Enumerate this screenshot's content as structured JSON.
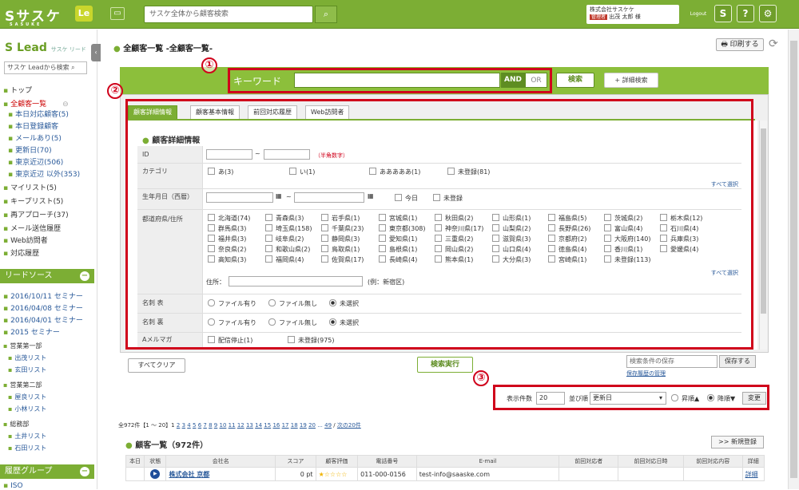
{
  "topbar": {
    "logo": "Sサスケ",
    "logo_sub": "SASUKE",
    "app_badge": "Le",
    "global_search_placeholder": "サスケ全体から顧客検索",
    "company": "株式会社サスケケ",
    "user_role": "管理者",
    "user_name": "出茂 太郎 様",
    "logout": "Logout"
  },
  "sidebar": {
    "logo": "Lead",
    "logo_sub": "サスケ リード",
    "search_placeholder": "サスケ Leadから検索",
    "items": [
      {
        "label": "トップ",
        "type": "top"
      },
      {
        "label": "全顧客一覧",
        "type": "red"
      },
      {
        "label": "本日対応顧客(5)",
        "type": "sub"
      },
      {
        "label": "本日登録顧客",
        "type": "sub"
      },
      {
        "label": "メールあり(5)",
        "type": "sub"
      },
      {
        "label": "更新日(70)",
        "type": "sub"
      },
      {
        "label": "東京近辺(506)",
        "type": "sub"
      },
      {
        "label": "東京近辺 以外(353)",
        "type": "sub"
      },
      {
        "label": "マイリスト(5)",
        "type": "top"
      },
      {
        "label": "キープリスト(5)",
        "type": "top"
      },
      {
        "label": "再アプローチ(37)",
        "type": "top"
      },
      {
        "label": "メール送信履歴",
        "type": "top"
      },
      {
        "label": "Web訪問者",
        "type": "top"
      },
      {
        "label": "対応履歴",
        "type": "top"
      }
    ],
    "lead_source_head": "リードソース",
    "lead_items": [
      "2016/10/11 セミナー",
      "2016/04/08 セミナー",
      "2016/04/01 セミナー",
      "2015 セミナー"
    ],
    "groups": [
      {
        "label": "営業第一部",
        "subs": [
          "出茂リスト",
          "玄田リスト"
        ]
      },
      {
        "label": "営業第二部",
        "subs": [
          "屋良リスト",
          "小林リスト"
        ]
      },
      {
        "label": "総務部",
        "subs": [
          "土井リスト",
          "石田リスト"
        ]
      }
    ],
    "history_head": "履歴グループ",
    "history_item": "ISO"
  },
  "main": {
    "breadcrumb": "全顧客一覧 -全顧客一覧-",
    "print": "印刷する",
    "keyword_label": "キーワード",
    "and": "AND",
    "or": "OR",
    "search": "検索",
    "advanced": "+ 詳細検索",
    "callouts": [
      "①",
      "②",
      "③"
    ]
  },
  "tabs": [
    "顧客詳細情報",
    "顧客基本情報",
    "前回対応履歴",
    "Web訪問者"
  ],
  "form": {
    "section_title": "顧客詳細情報",
    "id_label": "ID",
    "id_note": "（半角数字）",
    "category_label": "カテゴリ",
    "categories": [
      "あ(3)",
      "い(1)",
      "あああああ(1)",
      "未登録(81)"
    ],
    "select_all": "すべて選択",
    "birth_label": "生年月日（西暦）",
    "today": "今日",
    "unregistered": "未登録",
    "pref_label": "都道府県/住所",
    "prefs": [
      [
        "北海道(74)",
        "青森県(3)",
        "岩手県(1)",
        "宮城県(1)",
        "秋田県(2)",
        "山形県(1)",
        "福島県(5)",
        "茨城県(2)",
        "栃木県(12)"
      ],
      [
        "群馬県(3)",
        "埼玉県(158)",
        "千葉県(23)",
        "東京都(308)",
        "神奈川県(17)",
        "山梨県(2)",
        "長野県(26)",
        "富山県(4)",
        "石川県(4)"
      ],
      [
        "福井県(3)",
        "岐阜県(2)",
        "静岡県(3)",
        "愛知県(1)",
        "三重県(2)",
        "滋賀県(3)",
        "京都府(2)",
        "大阪府(140)",
        "兵庫県(3)"
      ],
      [
        "奈良県(2)",
        "和歌山県(2)",
        "鳥取県(1)",
        "島根県(1)",
        "岡山県(2)",
        "山口県(4)",
        "徳島県(4)",
        "香川県(1)",
        "愛媛県(4)"
      ],
      [
        "高知県(3)",
        "福岡県(4)",
        "佐賀県(17)",
        "長崎県(4)",
        "熊本県(1)",
        "大分県(3)",
        "宮崎県(1)",
        "未登録(113)",
        ""
      ]
    ],
    "address_label": "住所：",
    "address_example": "(例：新宿区)",
    "card_front_label": "名刺 表",
    "card_back_label": "名刺 裏",
    "file_yes": "ファイル有り",
    "file_no": "ファイル無し",
    "not_selected": "未選択",
    "amail_label": "Aメルマガ",
    "stop_delivery": "配信停止(1)",
    "unreg_975": "未登録(975)"
  },
  "actions": {
    "clear_all": "すべてクリア",
    "execute": "検索実行",
    "save_placeholder": "検索条件の保存",
    "save": "保存する",
    "save_history": "保存履歴の管理"
  },
  "sort": {
    "count_label": "表示件数",
    "count": "20",
    "order_label": "並び順",
    "order": "更新日",
    "asc": "昇順▲",
    "desc": "降順▼",
    "change": "変更"
  },
  "pager": {
    "summary": "全972件【1 ～ 20】1",
    "pages": [
      "2",
      "3",
      "4",
      "5",
      "6",
      "7",
      "8",
      "9",
      "10",
      "11",
      "12",
      "13",
      "14",
      "15",
      "16",
      "17",
      "18",
      "19",
      "20",
      "...",
      "49"
    ],
    "next": "次の20件"
  },
  "list": {
    "title": "顧客一覧（972件）",
    "new": ">> 新規登録",
    "columns": [
      "本日",
      "状態",
      "会社名",
      "スコア",
      "顧客評価",
      "電話番号",
      "E-mail",
      "前回対応者",
      "前回対応日時",
      "前回対応内容",
      "詳細"
    ],
    "rows": [
      {
        "company": "株式会社 京都",
        "score": "0 pt",
        "stars": "★☆☆☆☆",
        "phone": "011-000-0156",
        "email": "test-info@saaske.com",
        "detail": "詳細"
      }
    ]
  },
  "colors": {
    "accent": "#7cae34",
    "callout": "#d0021b",
    "link": "#2a5a9a"
  }
}
